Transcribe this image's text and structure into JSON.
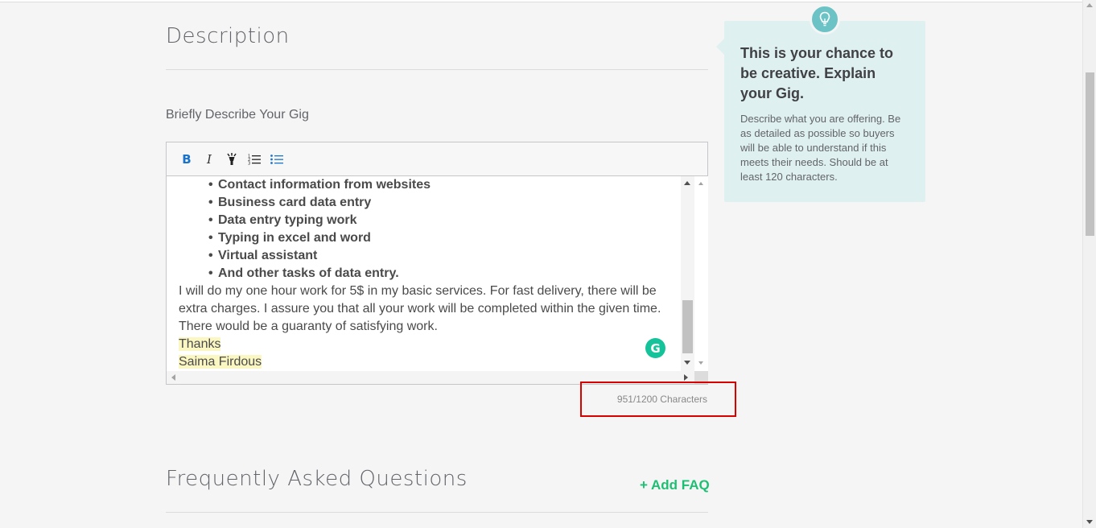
{
  "description": {
    "title": "Description",
    "field_label": "Briefly Describe Your Gig",
    "toolbar": {
      "bold": "B",
      "italic": "I",
      "highlight_icon": "highlighter-icon",
      "ordered_list_icon": "ordered-list-icon",
      "bullet_list_icon": "bullet-list-icon"
    },
    "bullets": [
      "Contact information from websites",
      "Business card data entry",
      "Data entry typing work",
      "Typing in excel and word",
      "Virtual assistant",
      "And other tasks of data entry."
    ],
    "paragraph": "I will do my one hour work for 5$ in my basic services. For fast delivery, there will be extra charges. I assure you that all your work will be completed within the given time. There would be a guaranty of satisfying work.",
    "closing_1": "Thanks",
    "closing_2": "Saima Firdous",
    "grammarly_letter": "G",
    "char_count": "951/1200 Characters"
  },
  "faq": {
    "title": "Frequently Asked Questions",
    "add_label": "+ Add FAQ"
  },
  "tip": {
    "icon": "lightbulb-icon",
    "title": "This is your chance to be creative. Explain your Gig.",
    "body": "Describe what you are offering. Be as detailed as possible so buyers will be able to understand if this meets their needs. Should be at least 120 characters."
  },
  "colors": {
    "accent_green": "#1dbf73",
    "tip_bg": "#dff0f0",
    "tip_icon": "#6cc3c6",
    "highlight_box": "#d90000",
    "bold_button": "#1a73c8"
  }
}
